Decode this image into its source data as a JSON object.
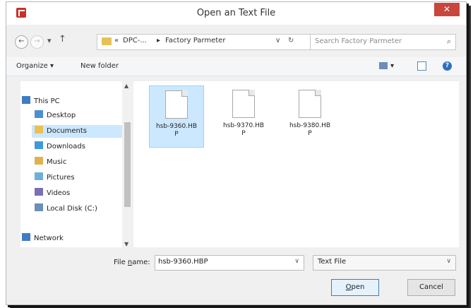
{
  "window": {
    "title": "Open an Text File",
    "close_glyph": "✕"
  },
  "nav": {
    "back_glyph": "←",
    "forward_glyph": "→",
    "recent_glyph": "▾",
    "up_glyph": "↑",
    "breadcrumb": {
      "overflow": "«",
      "parent": "DPC-...",
      "separator": "▸",
      "current": "Factory Parmeter"
    },
    "dropdown_glyph": "∨",
    "refresh_glyph": "↻",
    "search_placeholder": "Search Factory Parmeter",
    "search_glyph": "⌕"
  },
  "toolbar": {
    "organize": "Organize ▾",
    "new_folder": "New folder",
    "view_dropdown": "▾",
    "help": "?"
  },
  "sidebar": {
    "items": [
      {
        "label": "This PC",
        "icon": "computer-icon",
        "color": "#3e7cc4"
      },
      {
        "label": "Desktop",
        "icon": "desktop-folder-icon",
        "color": "#4b8fd3"
      },
      {
        "label": "Documents",
        "icon": "documents-folder-icon",
        "color": "#e8c156",
        "selected": true
      },
      {
        "label": "Downloads",
        "icon": "downloads-folder-icon",
        "color": "#3d9ad9"
      },
      {
        "label": "Music",
        "icon": "music-folder-icon",
        "color": "#e0b24a"
      },
      {
        "label": "Pictures",
        "icon": "pictures-folder-icon",
        "color": "#6fb0d9"
      },
      {
        "label": "Videos",
        "icon": "videos-folder-icon",
        "color": "#7a6fb0"
      },
      {
        "label": "Local Disk (C:)",
        "icon": "disk-icon",
        "color": "#6b8fb6"
      },
      {
        "label": "Network",
        "icon": "network-icon",
        "color": "#3e7cc4"
      }
    ]
  },
  "files": [
    {
      "name": "hsb-9360.HBP",
      "selected": true
    },
    {
      "name": "hsb-9370.HBP",
      "selected": false
    },
    {
      "name": "hsb-9380.HBP",
      "selected": false
    }
  ],
  "bottom": {
    "filename_label_prefix": "File ",
    "filename_label_underlined": "n",
    "filename_label_suffix": "ame:",
    "filename_value": "hsb-9360.HBP",
    "filetype_value": "Text File",
    "dropdown_glyph": "∨",
    "open_label_underlined": "O",
    "open_label_rest": "pen",
    "cancel_label": "Cancel"
  }
}
